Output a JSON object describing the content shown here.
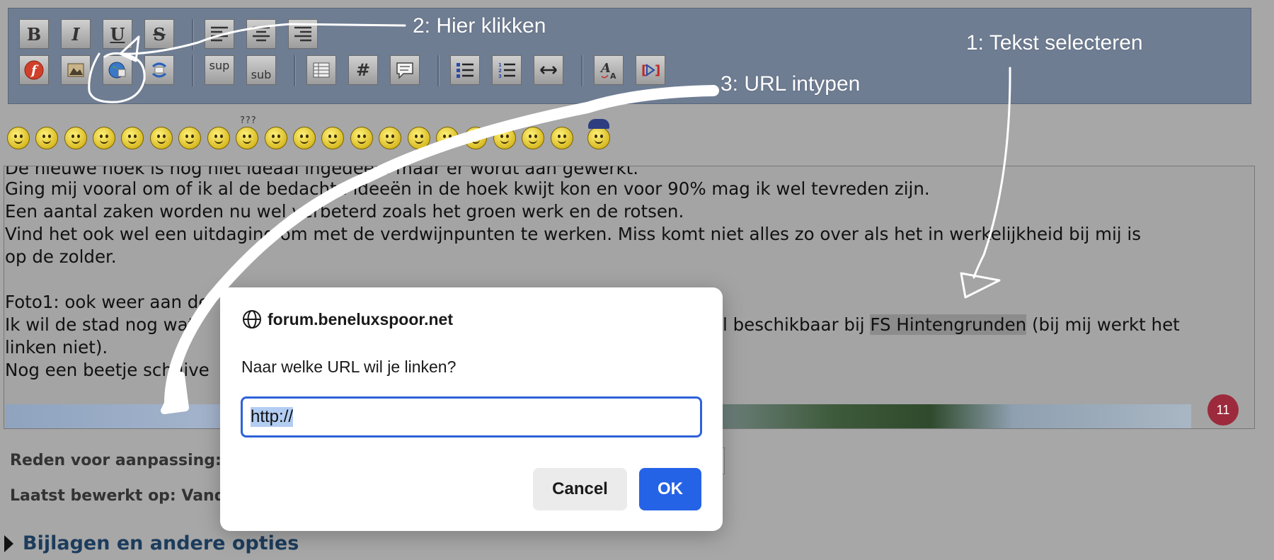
{
  "toolbar": {
    "row1": [
      {
        "name": "bold-button",
        "glyph": "B"
      },
      {
        "name": "italic-button",
        "glyph": "I"
      },
      {
        "name": "underline-button",
        "glyph": "U"
      },
      {
        "name": "strikethrough-button",
        "glyph": "S"
      },
      {
        "name": "align-left-button",
        "glyph": ""
      },
      {
        "name": "align-center-button",
        "glyph": ""
      },
      {
        "name": "align-right-button",
        "glyph": ""
      }
    ],
    "sup_label": "sup",
    "sub_label": "sub",
    "code_label": "#"
  },
  "smileys": {
    "question_label": "???"
  },
  "editor": {
    "lines": [
      "De nieuwe hoek is nog niet ideaal ingedeeld maar er wordt aan gewerkt.",
      "Ging mij vooral om of ik al de bedachte ideeën in de hoek kwijt kon en voor 90% mag ik wel tevreden zijn.",
      "Een aantal zaken worden nu wel verbeterd zoals het groen werk en de rotsen.",
      "Vind het ook wel een uitdaging om met de verdwijnpunten te werken. Miss komt niet alles zo over als het in werkelijkheid bij mij is",
      "op de zolder.",
      "",
      "Foto1: ook weer aan de",
      "Ik wil de stad nog wat",
      "linken niet).",
      "Nog een beetje schuive"
    ],
    "line7_tail": "al beschikbaar bij ",
    "selected_text": "FS Hintengrunden",
    "line7_end": " (bij mij werkt het",
    "badge_count": "11"
  },
  "form": {
    "reason_label": "Reden voor aanpassing:",
    "last_edited_label": "Laatst bewerkt op: Vand",
    "attachments_link": "Bijlagen en andere opties"
  },
  "dialog": {
    "host": "forum.beneluxspoor.net",
    "message": "Naar welke URL wil je linken?",
    "input_value": "http://",
    "cancel_label": "Cancel",
    "ok_label": "OK"
  },
  "annotations": {
    "step1": "1: Tekst selecteren",
    "step2": "2: Hier klikken",
    "step3": "3: URL intypen"
  }
}
